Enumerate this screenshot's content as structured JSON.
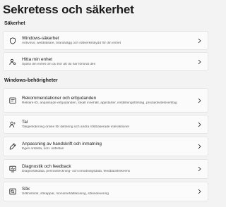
{
  "page": {
    "title": "Sekretess och säkerhet"
  },
  "sections": {
    "security": {
      "header": "Säkerhet"
    },
    "windows_permissions": {
      "header": "Windows-behörigheter"
    }
  },
  "items": [
    {
      "icon": "shield-icon",
      "title": "Windows-säkerhet",
      "subtitle": "Antivirus, webbläsare, brandvägg och nätverksskydd för din enhet"
    },
    {
      "icon": "location-person-icon",
      "title": "Hitta min enhet",
      "subtitle": "Spåra din enhet om du tror att du har förlorat den"
    },
    {
      "icon": "recommendations-icon",
      "title": "Rekommendationer och erbjudanden",
      "subtitle": "Reklam-ID, anpassade erbjudanden, lokalt innehåll, appstarter, inställningsförslag, produktivitetsverktyg"
    },
    {
      "icon": "speech-icon",
      "title": "Tal",
      "subtitle": "Taligenkänning online för diktering och andra röstbaserade interaktioner"
    },
    {
      "icon": "handwriting-icon",
      "title": "Anpassning av handskrift och inmatning",
      "subtitle": "Egen ordlista, ord i ordlistan"
    },
    {
      "icon": "diagnostics-icon",
      "title": "Diagnostik och feedback",
      "subtitle": "Diagnostikdata, pennanteckning- och inmatningsdata, feedbackfrekvens"
    },
    {
      "icon": "search-icon",
      "title": "Sök",
      "subtitle": "Sökhistorik, sökappar, moninnehållskoning, sökindexering"
    }
  ]
}
